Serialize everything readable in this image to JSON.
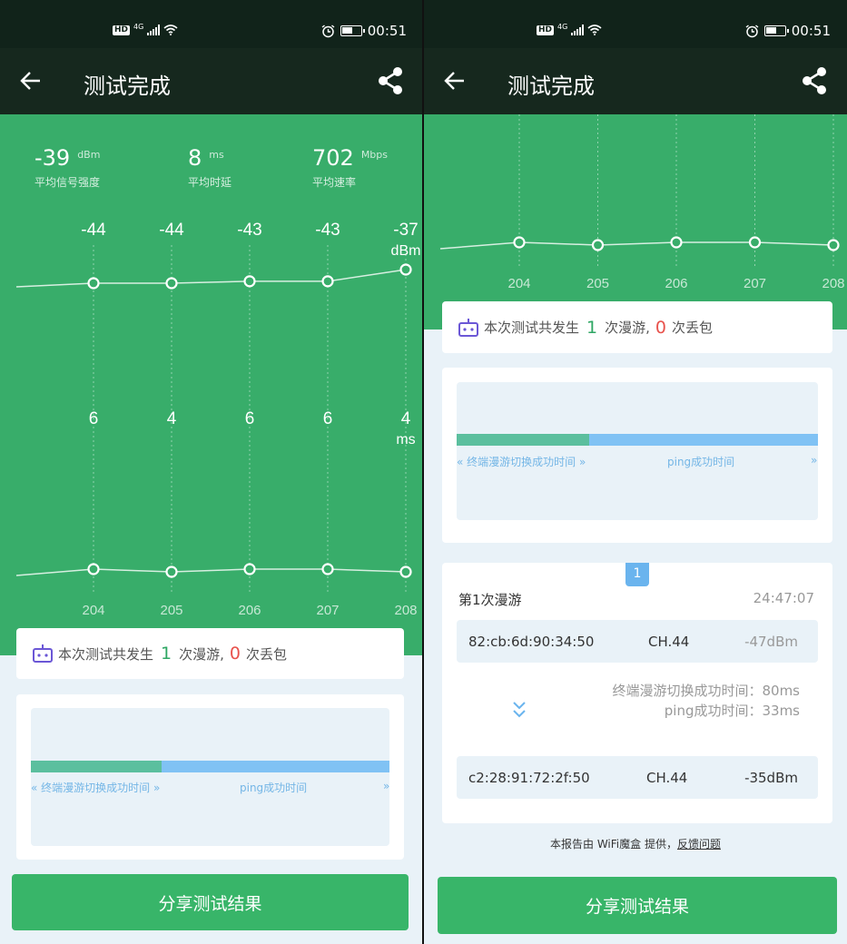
{
  "status": {
    "time": "00:51",
    "hd": "HD",
    "network": "4G"
  },
  "appbar": {
    "title": "测试完成"
  },
  "stats": [
    {
      "value": "-39",
      "unit": "dBm",
      "label": "平均信号强度"
    },
    {
      "value": "8",
      "unit": "ms",
      "label": "平均时延"
    },
    {
      "value": "702",
      "unit": "Mbps",
      "label": "平均速率"
    }
  ],
  "chart_data": [
    {
      "type": "line",
      "x": [
        "204",
        "205",
        "206",
        "207",
        "208"
      ],
      "values": [
        -44,
        -44,
        -43,
        -43,
        -37
      ],
      "unit": "dBm"
    },
    {
      "type": "line",
      "x": [
        "204",
        "205",
        "206",
        "207",
        "208"
      ],
      "values": [
        6,
        4,
        6,
        6,
        4
      ],
      "unit": "ms"
    }
  ],
  "summary": {
    "prefix": "本次测试共发生",
    "roam_count": "1",
    "roam_text": "次漫游,",
    "loss_count": "0",
    "loss_text": "次丢包"
  },
  "timeline": {
    "switch_label": "终端漫游切换成功时间",
    "ping_label": "ping成功时间"
  },
  "roam": {
    "badge": "1",
    "title": "第1次漫游",
    "time": "24:47:07",
    "from": {
      "mac": "82:cb:6d:90:34:50",
      "channel": "CH.44",
      "signal": "-47dBm"
    },
    "switch_time": "终端漫游切换成功时间：80ms",
    "ping_time": "ping成功时间：33ms",
    "to": {
      "mac": "c2:28:91:72:2f:50",
      "channel": "CH.44",
      "signal": "-35dBm"
    }
  },
  "footer": {
    "text": "本报告由 WiFi魔盒 提供，",
    "link": "反馈问题"
  },
  "share_button": "分享测试结果",
  "colors": {
    "green": "#38ad6a",
    "dark": "#16281e",
    "button": "#38b569",
    "switch_bar": "#5bbf9e",
    "ping_bar": "#80c2f4"
  }
}
